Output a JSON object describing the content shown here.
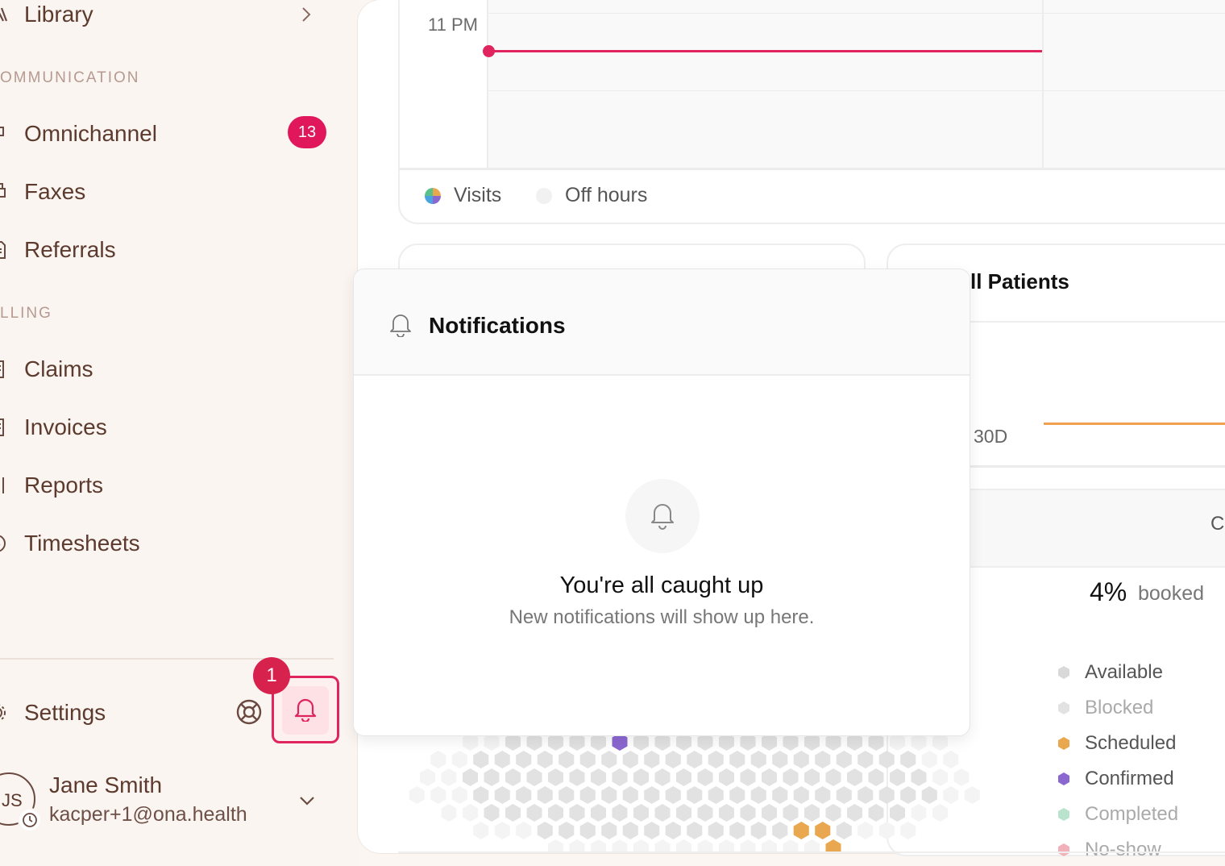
{
  "sidebar": {
    "library_label": "Library",
    "section_communication": "OMMUNICATION",
    "omnichannel_label": "Omnichannel",
    "omnichannel_badge": "13",
    "faxes_label": "Faxes",
    "referrals_label": "Referrals",
    "section_billing": "LLING",
    "claims_label": "Claims",
    "invoices_label": "Invoices",
    "reports_label": "Reports",
    "timesheets_label": "Timesheets",
    "settings_label": "Settings",
    "notification_count": "1",
    "user": {
      "initials": "JS",
      "name": "Jane Smith",
      "email": "kacper+1@ona.health"
    }
  },
  "calendar": {
    "time_label": "11 PM",
    "legend": {
      "visits": "Visits",
      "off_hours": "Off hours"
    }
  },
  "patients_card": {
    "title": "ll Patients",
    "range_label": "30D",
    "column_letter": "C",
    "booked_pct": "4%",
    "booked_label": "booked",
    "statuses": [
      {
        "label": "Available",
        "color": "#d4d4d4"
      },
      {
        "label": "Blocked",
        "color": "#dedede"
      },
      {
        "label": "Scheduled",
        "color": "#e9a84f"
      },
      {
        "label": "Confirmed",
        "color": "#8b67d0"
      },
      {
        "label": "Completed",
        "color": "#a8dcc0"
      },
      {
        "label": "No-show",
        "color": "#f2b0b8"
      }
    ]
  },
  "notifications": {
    "title": "Notifications",
    "empty_title": "You're all caught up",
    "empty_subtitle": "New notifications will show up here."
  },
  "colors": {
    "accent": "#e0245e",
    "sidebar_bg": "#fbf5f1",
    "text_brown": "#5c3a2e"
  }
}
